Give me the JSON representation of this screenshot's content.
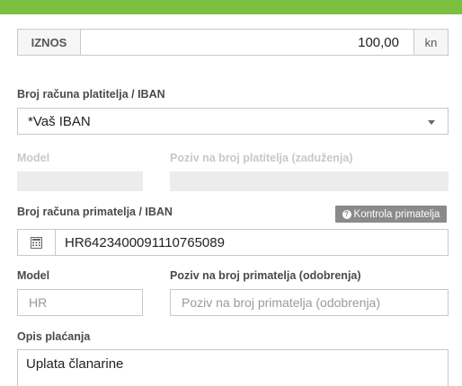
{
  "colors": {
    "accent": "#7cbf3f",
    "badge": "#8a8a8a"
  },
  "amount": {
    "label": "IZNOS",
    "value": "100,00",
    "currency": "kn"
  },
  "payer": {
    "iban_label": "Broj računa platitelja / IBAN",
    "iban_selected": "*Vaš IBAN",
    "model_label": "Model",
    "reference_label": "Poziv na broj platitelja (zaduženja)"
  },
  "recipient": {
    "iban_label": "Broj računa primatelja / IBAN",
    "check_button": "Kontrola primatelja",
    "iban_value": "HR6423400091110765089",
    "model_label": "Model",
    "model_value": "HR",
    "reference_label": "Poziv na broj primatelja (odobrenja)",
    "reference_placeholder": "Poziv na broj primatelja (odobrenja)"
  },
  "description": {
    "label": "Opis plaćanja",
    "value": "Uplata članarine"
  },
  "icons": {
    "calculator": "calculator-icon",
    "help": "question-circle-icon",
    "dropdown": "caret-down-icon"
  }
}
